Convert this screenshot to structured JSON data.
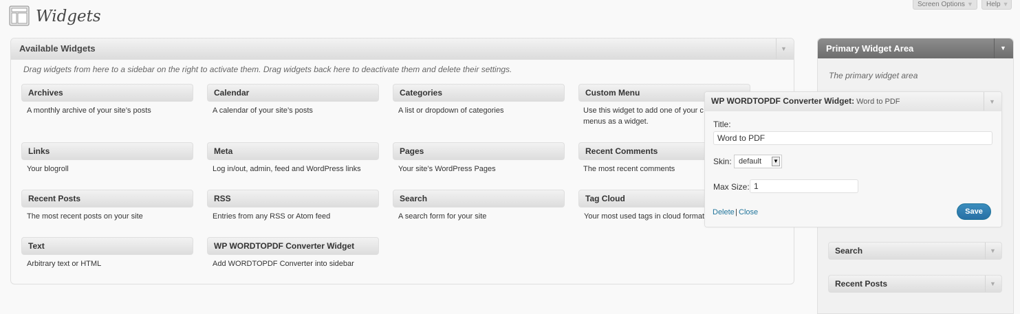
{
  "header": {
    "title": "Widgets",
    "screen_options_label": "Screen Options",
    "help_label": "Help"
  },
  "available": {
    "title": "Available Widgets",
    "description": "Drag widgets from here to a sidebar on the right to activate them. Drag widgets back here to deactivate them and delete their settings.",
    "widgets": [
      {
        "title": "Archives",
        "desc": "A monthly archive of your site’s posts"
      },
      {
        "title": "Calendar",
        "desc": "A calendar of your site’s posts"
      },
      {
        "title": "Categories",
        "desc": "A list or dropdown of categories"
      },
      {
        "title": "Custom Menu",
        "desc": "Use this widget to add one of your c",
        "desc2": "menus as a widget."
      },
      {
        "title": "Links",
        "desc": "Your blogroll"
      },
      {
        "title": "Meta",
        "desc": "Log in/out, admin, feed and WordPress links"
      },
      {
        "title": "Pages",
        "desc": "Your site’s WordPress Pages"
      },
      {
        "title": "Recent Comments",
        "desc": "The most recent comments"
      },
      {
        "title": "Recent Posts",
        "desc": "The most recent posts on your site"
      },
      {
        "title": "RSS",
        "desc": "Entries from any RSS or Atom feed"
      },
      {
        "title": "Search",
        "desc": "A search form for your site"
      },
      {
        "title": "Tag Cloud",
        "desc": "Your most used tags in cloud format"
      },
      {
        "title": "Text",
        "desc": "Arbitrary text or HTML"
      },
      {
        "title": "WP WORDTOPDF Converter Widget",
        "desc": "Add WORDTOPDF Converter into sidebar"
      }
    ]
  },
  "sidebar": {
    "title": "Primary Widget Area",
    "description": "The primary widget area",
    "widgets": [
      {
        "title": "Search"
      },
      {
        "title": "Recent Posts"
      }
    ]
  },
  "open_widget": {
    "title": "WP WORDTOPDF Converter Widget:",
    "in_widget_title": "Word to PDF",
    "title_label": "Title:",
    "title_value": "Word to PDF",
    "skin_label": "Skin:",
    "skin_value": "default",
    "max_size_label": "Max Size:",
    "max_size_value": "1",
    "delete_label": "Delete",
    "separator": "|",
    "close_label": "Close",
    "save_label": "Save"
  },
  "icons": {
    "page_icon": "widgets-layout-icon",
    "toggle_arrow": "▼"
  },
  "colors": {
    "sidebar_header": "#797979",
    "link": "#21759b",
    "save_button": "#2e7eb3"
  }
}
